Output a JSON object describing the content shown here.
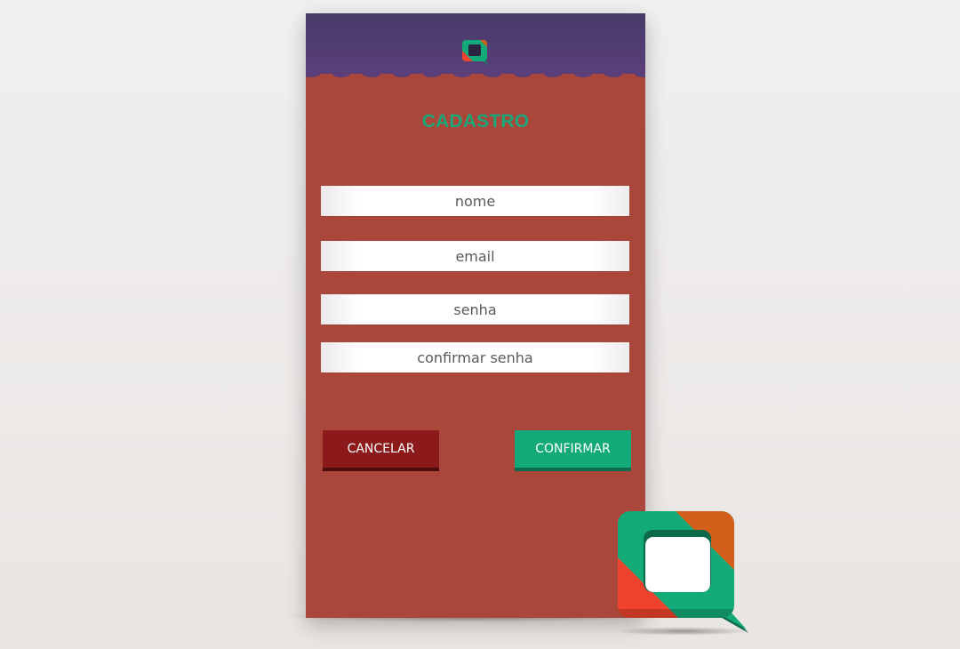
{
  "screen": {
    "title": "CADASTRO"
  },
  "form": {
    "fields": [
      {
        "name": "nome",
        "placeholder": "nome",
        "value": ""
      },
      {
        "name": "email",
        "placeholder": "email",
        "value": ""
      },
      {
        "name": "senha",
        "placeholder": "senha",
        "value": ""
      },
      {
        "name": "confirmar-senha",
        "placeholder": "confirmar senha",
        "value": ""
      }
    ]
  },
  "buttons": {
    "cancel_label": "CANCELAR",
    "confirm_label": "CONFIRMAR"
  },
  "icons": {
    "header_logo": "chat-bubble-logo-icon",
    "brand_logo": "chat-bubble-logo-icon"
  },
  "colors": {
    "header": "#4f3d72",
    "background": "#ab473a",
    "accent_green": "#13aa7a",
    "cancel_red": "#8c1a1a",
    "logo_orange": "#d2601a",
    "logo_red": "#f0432d"
  }
}
